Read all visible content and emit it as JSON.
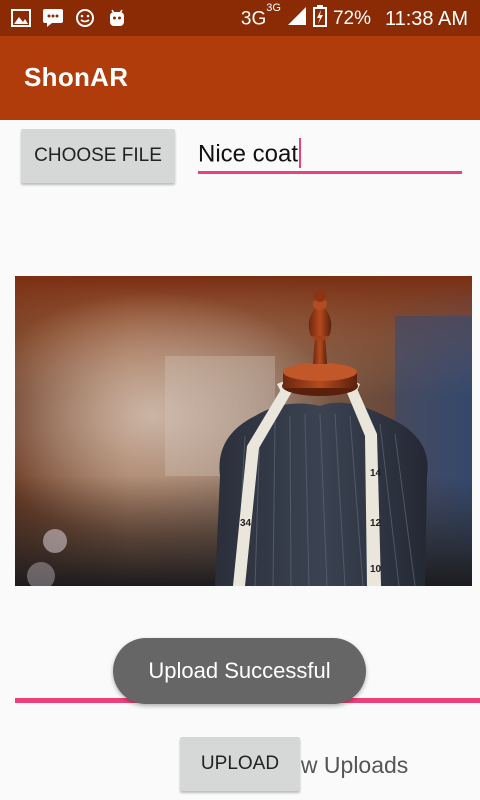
{
  "status_bar": {
    "network": "3G",
    "network_sup": "3G",
    "battery": "72%",
    "time": "11:38 AM"
  },
  "app_bar": {
    "title": "ShonAR"
  },
  "choose_file_label": "CHOOSE FILE",
  "title_input_value": "Nice coat",
  "upload_label": "UPLOAD",
  "show_uploads_label": "Show Uploads",
  "toast": "Upload Successful",
  "colors": {
    "status_bar": "#8a2b06",
    "app_bar": "#b03c0b",
    "accent": "#ec407a"
  }
}
